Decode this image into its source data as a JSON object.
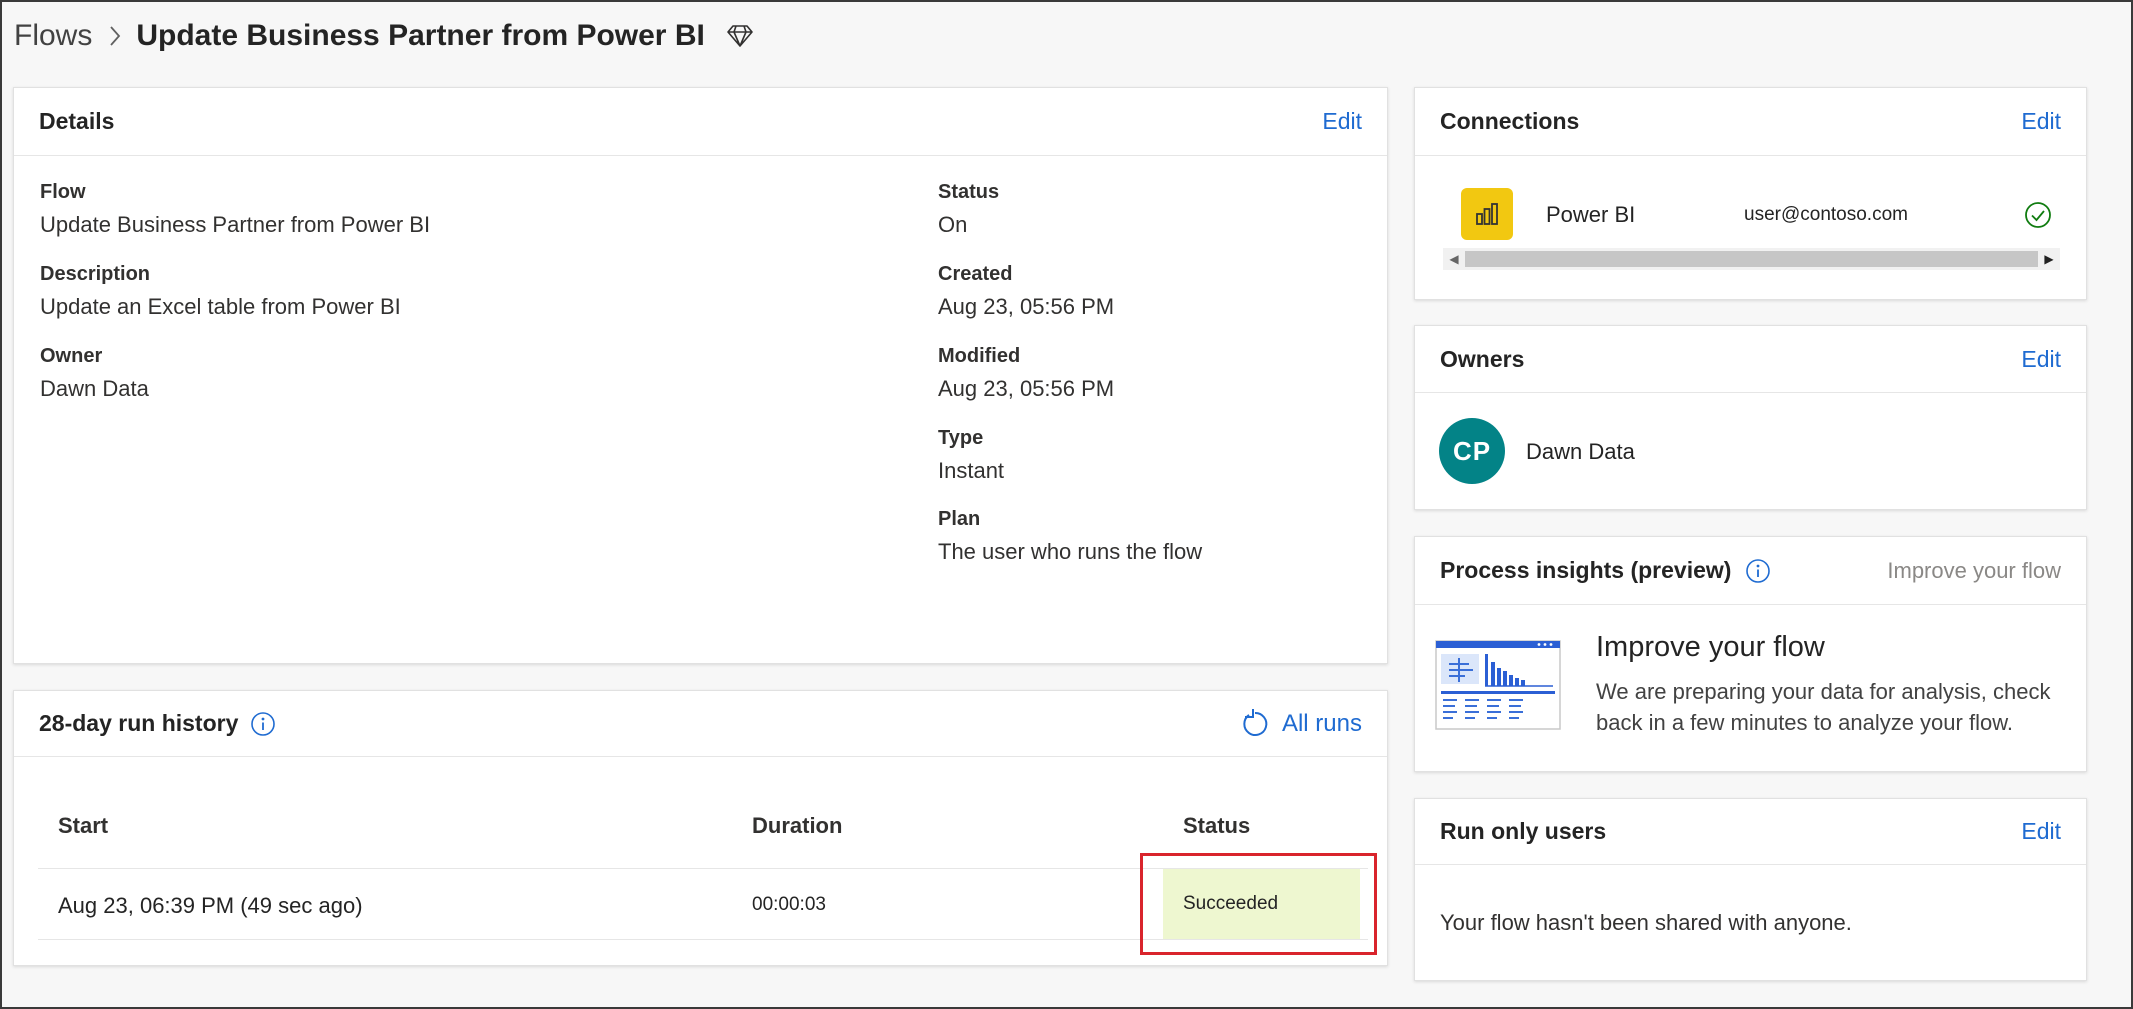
{
  "breadcrumb": {
    "root": "Flows",
    "title": "Update Business Partner from Power BI",
    "premium_icon": "diamond-icon"
  },
  "details": {
    "title": "Details",
    "edit_label": "Edit",
    "left_fields": [
      {
        "label": "Flow",
        "value": "Update Business Partner from Power BI"
      },
      {
        "label": "Description",
        "value": "Update an Excel table from Power BI"
      },
      {
        "label": "Owner",
        "value": "Dawn Data"
      }
    ],
    "right_fields": [
      {
        "label": "Status",
        "value": "On"
      },
      {
        "label": "Created",
        "value": "Aug 23, 05:56 PM"
      },
      {
        "label": "Modified",
        "value": "Aug 23, 05:56 PM"
      },
      {
        "label": "Type",
        "value": "Instant"
      },
      {
        "label": "Plan",
        "value": "The user who runs the flow"
      }
    ]
  },
  "run_history": {
    "title": "28-day run history",
    "all_runs_label": "All runs",
    "columns": [
      "Start",
      "Duration",
      "Status"
    ],
    "rows": [
      {
        "start": "Aug 23, 06:39 PM (49 sec ago)",
        "duration": "00:00:03",
        "status": "Succeeded"
      }
    ]
  },
  "connections": {
    "title": "Connections",
    "edit_label": "Edit",
    "items": [
      {
        "name": "Power BI",
        "account": "user@contoso.com",
        "icon": "power-bi-icon",
        "status_icon": "check-circle-icon"
      }
    ]
  },
  "owners": {
    "title": "Owners",
    "edit_label": "Edit",
    "items": [
      {
        "initials": "CP",
        "name": "Dawn Data"
      }
    ]
  },
  "process_insights": {
    "title": "Process insights (preview)",
    "action_label": "Improve your flow",
    "heading": "Improve your flow",
    "body": "We are preparing your data for analysis, check back in a few minutes to analyze your flow."
  },
  "run_only_users": {
    "title": "Run only users",
    "edit_label": "Edit",
    "message": "Your flow hasn't been shared with anyone."
  },
  "colors": {
    "accent": "#1f6bd1",
    "success_bg": "#eef7d0",
    "success_icon": "#107c10",
    "avatar_bg": "#038387",
    "power_bi": "#f2c811",
    "highlight": "#d9242c"
  }
}
